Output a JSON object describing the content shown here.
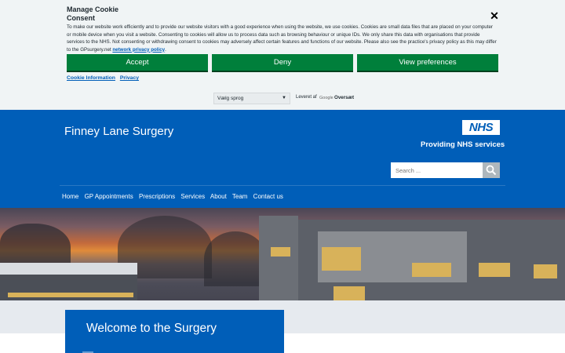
{
  "cookie": {
    "title": "Manage Cookie Consent",
    "close_icon": "close-icon",
    "text": "To make our website work efficiently and to provide our website visitors with a good experience when using the website, we use cookies. Cookies are small data files that are placed on your computer or mobile device when you visit a website. Consenting to cookies will allow us to process data such as browsing behaviour or unique IDs. We only share this data with organisations that provide services to the NHS. Not consenting or withdrawing consent to cookies may adversely affect certain features and functions of our website. Please also see the practice's privacy policy as this may differ to the GPsurgery.net",
    "text_link": "network privacy policy",
    "text_end": ".",
    "accept_label": "Accept",
    "deny_label": "Deny",
    "prefs_label": "View preferences",
    "links": [
      "Cookie Information",
      "Privacy"
    ]
  },
  "translate": {
    "select_value": "Vælg sprog",
    "powered_by": "Leveret af",
    "google": "Google",
    "translate_label": "Oversæt"
  },
  "header": {
    "site_title": "Finney Lane Surgery",
    "nhs_logo": "NHS",
    "nhs_sub": "Providing NHS services",
    "search_placeholder": "Search ...",
    "search_icon": "search-icon"
  },
  "nav": {
    "items": [
      "Home",
      "GP Appointments",
      "Prescriptions",
      "Services",
      "About",
      "Team",
      "Contact us"
    ]
  },
  "hero": {
    "welcome": "Welcome to the Surgery"
  },
  "colors": {
    "nhs_blue": "#005eb8",
    "accept_green": "#007f3b",
    "banner_bg": "#f0f4f5"
  }
}
